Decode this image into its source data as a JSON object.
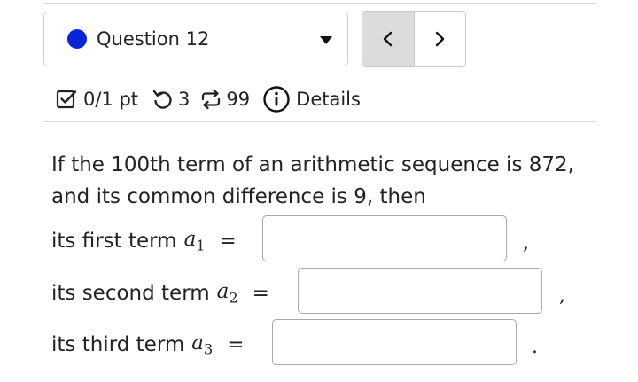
{
  "question_selector": {
    "label": "Question 12",
    "status_color": "#0b24d6"
  },
  "navigation": {
    "prev_label": "<",
    "next_label": ">"
  },
  "meta": {
    "score": "0/1 pt",
    "attempts_remaining": "3",
    "retry_count": "99",
    "details_label": "Details"
  },
  "problem": {
    "text": "If the 100th term of an arithmetic sequence is 872, and its common difference is 9, then",
    "answers": [
      {
        "prefix": "its first term",
        "var": "a",
        "sub": "1",
        "equals": "=",
        "value": "",
        "trail": ","
      },
      {
        "prefix": "its second term",
        "var": "a",
        "sub": "2",
        "equals": "=",
        "value": "",
        "trail": ","
      },
      {
        "prefix": "its third term",
        "var": "a",
        "sub": "3",
        "equals": "=",
        "value": "",
        "trail": "."
      }
    ]
  },
  "icons": {
    "score": "checkbox-icon",
    "attempts": "undo-icon",
    "retries": "repeat-icon",
    "details": "info-icon"
  }
}
